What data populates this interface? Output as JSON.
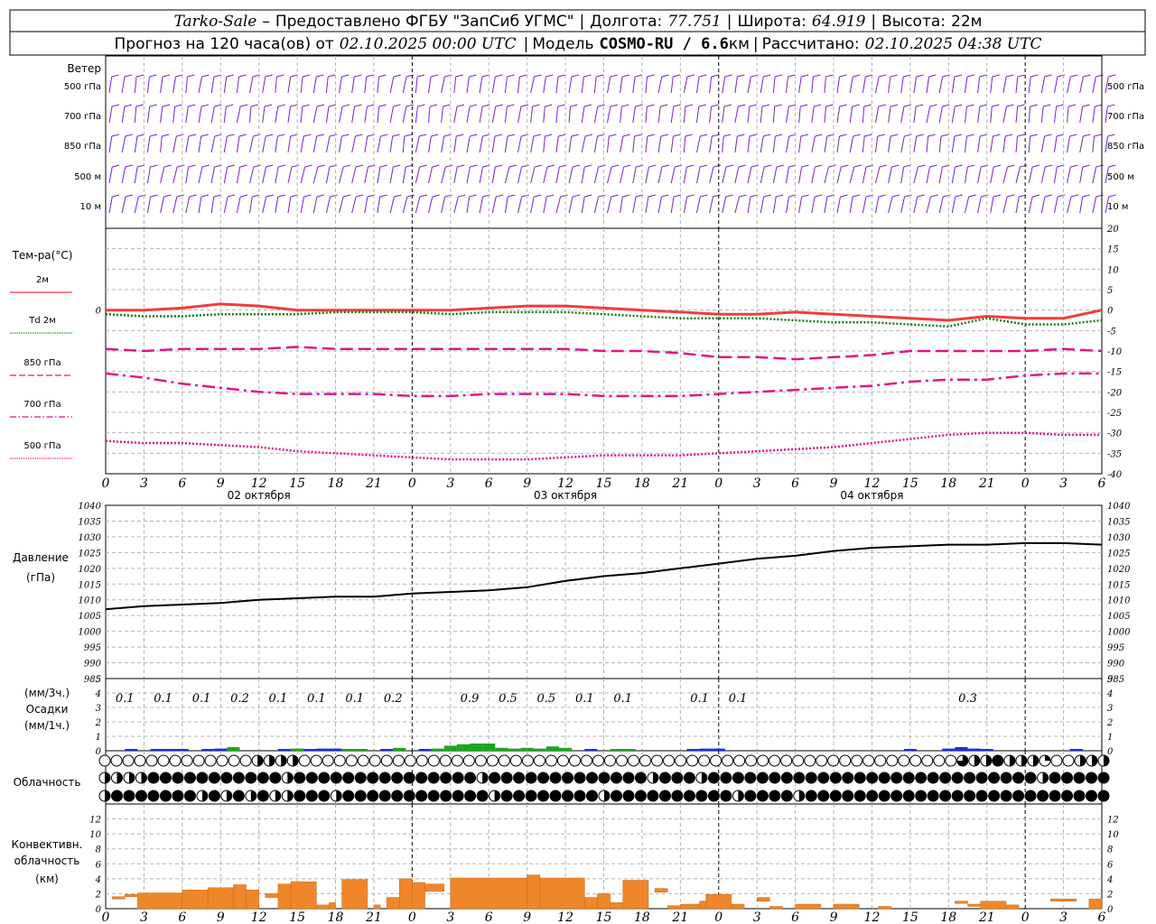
{
  "header": {
    "station": "Tarko-Sale",
    "dash": "–",
    "provider": "Предоставлено ФГБУ \"ЗапСиб УГМС\"",
    "lon_label": "Долгота:",
    "lon_value": "77.751",
    "lat_label": "Широта:",
    "lat_value": "64.919",
    "alt_label": "Высота:",
    "alt_value": "22м",
    "forecast_prefix": "Прогноз на 120 часа(ов) от",
    "forecast_start": "02.10.2025 00:00 UTC",
    "model_label": "Модель",
    "model_name": "COSMO-RU / 6.6",
    "model_unit": "км",
    "calc_label": "Рассчитано:",
    "calc_time": "02.10.2025 04:38 UTC"
  },
  "time_axis": {
    "hour_labels": [
      "0",
      "3",
      "6",
      "9",
      "12",
      "15",
      "18",
      "21",
      "0",
      "3",
      "6",
      "9",
      "12",
      "15",
      "18",
      "21",
      "0",
      "3",
      "6",
      "9",
      "12",
      "15",
      "18",
      "21",
      "0",
      "3",
      "6"
    ],
    "day_labels": [
      "02 октября",
      "03 октября",
      "04 октября"
    ],
    "day_boundary_hours": [
      24,
      48,
      72
    ]
  },
  "wind_panel": {
    "title": "Ветер",
    "levels": [
      "500 гПа",
      "700 гПа",
      "850 гПа",
      "500 м",
      "10 м"
    ],
    "color": "#7a1fd6"
  },
  "chart_data": [
    {
      "type": "line",
      "id": "temperature",
      "ylabel": "Тем-ра(°C)",
      "ylim": [
        -40,
        20
      ],
      "yticks": [
        20,
        15,
        10,
        5,
        0,
        -5,
        -10,
        -15,
        -20,
        -25,
        -30,
        -35,
        -40
      ],
      "x_hours": [
        0,
        3,
        6,
        9,
        12,
        15,
        18,
        21,
        24,
        27,
        30,
        33,
        36,
        39,
        42,
        45,
        48,
        51,
        54,
        57,
        60,
        63,
        66,
        69,
        72,
        75,
        78
      ],
      "series": [
        {
          "name": "2м",
          "color": "#f03c3c",
          "style": "solid",
          "values": [
            0,
            0,
            0.5,
            1.5,
            1,
            0,
            0,
            0,
            0,
            0,
            0.5,
            1,
            1,
            0.5,
            0,
            -0.5,
            -1,
            -1,
            -0.5,
            -1,
            -1.5,
            -2,
            -2.5,
            -1.5,
            -2,
            -2,
            0
          ]
        },
        {
          "name": "Td 2м",
          "color": "#137a13",
          "style": "dotted",
          "values": [
            -1,
            -1.5,
            -1.5,
            -1,
            -1,
            -1,
            -0.5,
            -0.5,
            -0.5,
            -1,
            -0.5,
            -0.5,
            -0.5,
            -1,
            -1.5,
            -2,
            -2,
            -2,
            -2.5,
            -3,
            -3,
            -3.5,
            -4,
            -2,
            -3.5,
            -3.5,
            -2.5
          ]
        },
        {
          "name": "850 гПа",
          "color": "#e0158a",
          "style": "dash",
          "values": [
            -9.5,
            -10,
            -9.5,
            -9.5,
            -9.5,
            -9,
            -9.5,
            -9.5,
            -9.5,
            -9.5,
            -9.5,
            -9.5,
            -9.5,
            -10,
            -10,
            -10.5,
            -11.5,
            -11.5,
            -12,
            -11.5,
            -11,
            -10,
            -10,
            -10,
            -10,
            -9.5,
            -10
          ]
        },
        {
          "name": "700 гПа",
          "color": "#e0158a",
          "style": "dashdot",
          "values": [
            -15.5,
            -16.5,
            -18,
            -19,
            -20,
            -20.5,
            -20.5,
            -20.5,
            -21,
            -21,
            -20.5,
            -20.5,
            -20.5,
            -21,
            -21,
            -21,
            -20.5,
            -20,
            -19.5,
            -19,
            -18.5,
            -17.5,
            -17,
            -17,
            -16,
            -15.5,
            -15.5
          ]
        },
        {
          "name": "500 гПа",
          "color": "#e0158a",
          "style": "dotted",
          "values": [
            -32,
            -32.5,
            -32.5,
            -33,
            -33.5,
            -34.5,
            -35,
            -35.5,
            -36,
            -36.5,
            -36.5,
            -36.5,
            -36,
            -35.5,
            -35.5,
            -35.5,
            -35,
            -34.5,
            -34,
            -33.5,
            -32.5,
            -31.5,
            -30.5,
            -30,
            -30,
            -30.5,
            -30.5
          ]
        }
      ]
    },
    {
      "type": "line",
      "id": "pressure",
      "ylabel": "Давление",
      "yunit": "(гПа)",
      "ylim": [
        985,
        1040
      ],
      "yticks": [
        1040,
        1035,
        1030,
        1025,
        1020,
        1015,
        1010,
        1005,
        1000,
        995,
        990,
        985
      ],
      "x_hours": [
        0,
        3,
        6,
        9,
        12,
        15,
        18,
        21,
        24,
        27,
        30,
        33,
        36,
        39,
        42,
        45,
        48,
        51,
        54,
        57,
        60,
        63,
        66,
        69,
        72,
        75,
        78
      ],
      "series": [
        {
          "name": "Давление",
          "color": "#000000",
          "style": "solid",
          "values": [
            1007,
            1008,
            1008.5,
            1009,
            1010,
            1010.5,
            1011,
            1011,
            1012,
            1012.5,
            1013,
            1014,
            1016,
            1017.5,
            1018.5,
            1020,
            1021.5,
            1023,
            1024,
            1025.5,
            1026.5,
            1027,
            1027.5,
            1027.5,
            1028,
            1028,
            1027.5
          ]
        }
      ]
    },
    {
      "type": "bar",
      "id": "precipitation",
      "ylabel": "(мм/3ч.)",
      "ylabel2": "Осадки",
      "ylabel3": "(мм/1ч.)",
      "ylim": [
        0,
        5
      ],
      "yticks": [
        5,
        4,
        3,
        2,
        1,
        0
      ],
      "totals_3h": [
        {
          "hour": 1.5,
          "text": "0.1"
        },
        {
          "hour": 4.5,
          "text": "0.1"
        },
        {
          "hour": 7.5,
          "text": "0.1"
        },
        {
          "hour": 10.5,
          "text": "0.2"
        },
        {
          "hour": 13.5,
          "text": "0.1"
        },
        {
          "hour": 16.5,
          "text": "0.1"
        },
        {
          "hour": 19.5,
          "text": "0.1"
        },
        {
          "hour": 22.5,
          "text": "0.2"
        },
        {
          "hour": 28.5,
          "text": "0.9"
        },
        {
          "hour": 31.5,
          "text": "0.5"
        },
        {
          "hour": 34.5,
          "text": "0.5"
        },
        {
          "hour": 37.5,
          "text": "0.1"
        },
        {
          "hour": 40.5,
          "text": "0.1"
        },
        {
          "hour": 46.5,
          "text": "0.1"
        },
        {
          "hour": 49.5,
          "text": "0.1"
        },
        {
          "hour": 67.5,
          "text": "0.3"
        }
      ],
      "hourly_mm": [
        {
          "h": 2,
          "v": 0.05,
          "c": "blue"
        },
        {
          "h": 4,
          "v": 0.08,
          "c": "blue"
        },
        {
          "h": 5,
          "v": 0.1,
          "c": "blue"
        },
        {
          "h": 6,
          "v": 0.12,
          "c": "blue"
        },
        {
          "h": 8,
          "v": 0.1,
          "c": "blue"
        },
        {
          "h": 9,
          "v": 0.15,
          "c": "blue"
        },
        {
          "h": 10,
          "v": 0.25,
          "c": "green"
        },
        {
          "h": 14,
          "v": 0.1,
          "c": "blue"
        },
        {
          "h": 15,
          "v": 0.15,
          "c": "green"
        },
        {
          "h": 16,
          "v": 0.1,
          "c": "blue"
        },
        {
          "h": 17,
          "v": 0.15,
          "c": "blue"
        },
        {
          "h": 18,
          "v": 0.15,
          "c": "blue"
        },
        {
          "h": 19,
          "v": 0.1,
          "c": "green"
        },
        {
          "h": 20,
          "v": 0.08,
          "c": "green"
        },
        {
          "h": 22,
          "v": 0.1,
          "c": "blue"
        },
        {
          "h": 23,
          "v": 0.2,
          "c": "green"
        },
        {
          "h": 25,
          "v": 0.1,
          "c": "blue"
        },
        {
          "h": 26,
          "v": 0.15,
          "c": "green"
        },
        {
          "h": 27,
          "v": 0.35,
          "c": "green"
        },
        {
          "h": 28,
          "v": 0.45,
          "c": "green"
        },
        {
          "h": 29,
          "v": 0.5,
          "c": "green"
        },
        {
          "h": 30,
          "v": 0.5,
          "c": "green"
        },
        {
          "h": 31,
          "v": 0.2,
          "c": "green"
        },
        {
          "h": 32,
          "v": 0.15,
          "c": "green"
        },
        {
          "h": 33,
          "v": 0.2,
          "c": "green"
        },
        {
          "h": 34,
          "v": 0.15,
          "c": "green"
        },
        {
          "h": 35,
          "v": 0.3,
          "c": "green"
        },
        {
          "h": 36,
          "v": 0.2,
          "c": "green"
        },
        {
          "h": 38,
          "v": 0.1,
          "c": "blue"
        },
        {
          "h": 40,
          "v": 0.1,
          "c": "green"
        },
        {
          "h": 41,
          "v": 0.1,
          "c": "green"
        },
        {
          "h": 46,
          "v": 0.1,
          "c": "blue"
        },
        {
          "h": 47,
          "v": 0.15,
          "c": "blue"
        },
        {
          "h": 48,
          "v": 0.15,
          "c": "blue"
        },
        {
          "h": 63,
          "v": 0.05,
          "c": "blue"
        },
        {
          "h": 66,
          "v": 0.15,
          "c": "blue"
        },
        {
          "h": 67,
          "v": 0.25,
          "c": "blue"
        },
        {
          "h": 68,
          "v": 0.15,
          "c": "blue"
        },
        {
          "h": 69,
          "v": 0.05,
          "c": "blue"
        },
        {
          "h": 76,
          "v": 0.05,
          "c": "blue"
        }
      ],
      "colors": {
        "blue": "#1a2ee0",
        "green": "#1aa81a"
      }
    },
    {
      "type": "bar",
      "id": "convective_cloud",
      "ylabel": "Конвективн.",
      "ylabel2": "облачность",
      "ylabel3": "(км)",
      "ylim": [
        0,
        14
      ],
      "yticks": [
        12,
        10,
        8,
        6,
        4,
        2,
        0
      ],
      "color": "#f0862a",
      "bars": [
        {
          "h0": 0.5,
          "h1": 1.5,
          "b": 1.3,
          "t": 1.6
        },
        {
          "h0": 1.5,
          "h1": 2.5,
          "b": 1.6,
          "t": 1.9
        },
        {
          "h0": 2.5,
          "h1": 6,
          "b": 0,
          "t": 2.1
        },
        {
          "h0": 6,
          "h1": 8,
          "b": 0,
          "t": 2.5
        },
        {
          "h0": 8,
          "h1": 10,
          "b": 0,
          "t": 2.8
        },
        {
          "h0": 10,
          "h1": 11,
          "b": 0,
          "t": 3.2
        },
        {
          "h0": 11,
          "h1": 12,
          "b": 0,
          "t": 2.5
        },
        {
          "h0": 12.5,
          "h1": 13.5,
          "b": 1.5,
          "t": 2.0
        },
        {
          "h0": 13.5,
          "h1": 14.5,
          "b": 0,
          "t": 3.3
        },
        {
          "h0": 14.5,
          "h1": 16.5,
          "b": 0,
          "t": 3.6
        },
        {
          "h0": 16.5,
          "h1": 17.5,
          "b": 0,
          "t": 0.5
        },
        {
          "h0": 17.5,
          "h1": 18,
          "b": 0,
          "t": 0.8
        },
        {
          "h0": 18.5,
          "h1": 20.5,
          "b": 0,
          "t": 3.9
        },
        {
          "h0": 21,
          "h1": 21.5,
          "b": 0,
          "t": 0.5
        },
        {
          "h0": 22,
          "h1": 23,
          "b": 0,
          "t": 1.5
        },
        {
          "h0": 23,
          "h1": 24,
          "b": 0,
          "t": 4.0
        },
        {
          "h0": 24,
          "h1": 25,
          "b": 0,
          "t": 3.5
        },
        {
          "h0": 25,
          "h1": 26.5,
          "b": 2.3,
          "t": 3.3
        },
        {
          "h0": 27,
          "h1": 33,
          "b": 0,
          "t": 4.1
        },
        {
          "h0": 33,
          "h1": 34,
          "b": 0,
          "t": 4.5
        },
        {
          "h0": 34,
          "h1": 37.5,
          "b": 0,
          "t": 4.1
        },
        {
          "h0": 37.5,
          "h1": 38.5,
          "b": 0,
          "t": 1.5
        },
        {
          "h0": 38.5,
          "h1": 39.5,
          "b": 0,
          "t": 2.0
        },
        {
          "h0": 39.5,
          "h1": 40.5,
          "b": 0,
          "t": 0.8
        },
        {
          "h0": 40.5,
          "h1": 42.5,
          "b": 0,
          "t": 3.8
        },
        {
          "h0": 43,
          "h1": 44,
          "b": 2.2,
          "t": 2.7
        },
        {
          "h0": 44,
          "h1": 45,
          "b": 0,
          "t": 0.4
        },
        {
          "h0": 45,
          "h1": 46.5,
          "b": 0,
          "t": 0.6
        },
        {
          "h0": 46.5,
          "h1": 47,
          "b": 0,
          "t": 1.0
        },
        {
          "h0": 47,
          "h1": 49,
          "b": 0,
          "t": 1.9
        },
        {
          "h0": 49,
          "h1": 50,
          "b": 0,
          "t": 0.6
        },
        {
          "h0": 51,
          "h1": 52,
          "b": 1.0,
          "t": 1.5
        },
        {
          "h0": 52,
          "h1": 53,
          "b": 0,
          "t": 0.3
        },
        {
          "h0": 54,
          "h1": 56,
          "b": 0,
          "t": 0.6
        },
        {
          "h0": 57,
          "h1": 59,
          "b": 0,
          "t": 0.6
        },
        {
          "h0": 60.5,
          "h1": 61.5,
          "b": 0,
          "t": 0.3
        },
        {
          "h0": 66.5,
          "h1": 67.5,
          "b": 0.7,
          "t": 1.0
        },
        {
          "h0": 67.5,
          "h1": 68.5,
          "b": 0.3,
          "t": 0.6
        },
        {
          "h0": 68.5,
          "h1": 70.5,
          "b": 0,
          "t": 1.0
        },
        {
          "h0": 70.5,
          "h1": 71.5,
          "b": 0,
          "t": 0.5
        },
        {
          "h0": 74,
          "h1": 76,
          "b": 1.0,
          "t": 1.3
        },
        {
          "h0": 77,
          "h1": 78,
          "b": 0,
          "t": 1.3
        }
      ]
    }
  ],
  "cloud_panel": {
    "title": "Облачность",
    "rows": [
      "00000000000002222000000000000000000000000000000000000000000000000000000003224222100222",
      "22224444444444424444444444444442444444444444424442444444444444444444444444444244444",
      "24444444242424224442444444444444244444444244444444442444424444444444444444444444444"
    ]
  }
}
